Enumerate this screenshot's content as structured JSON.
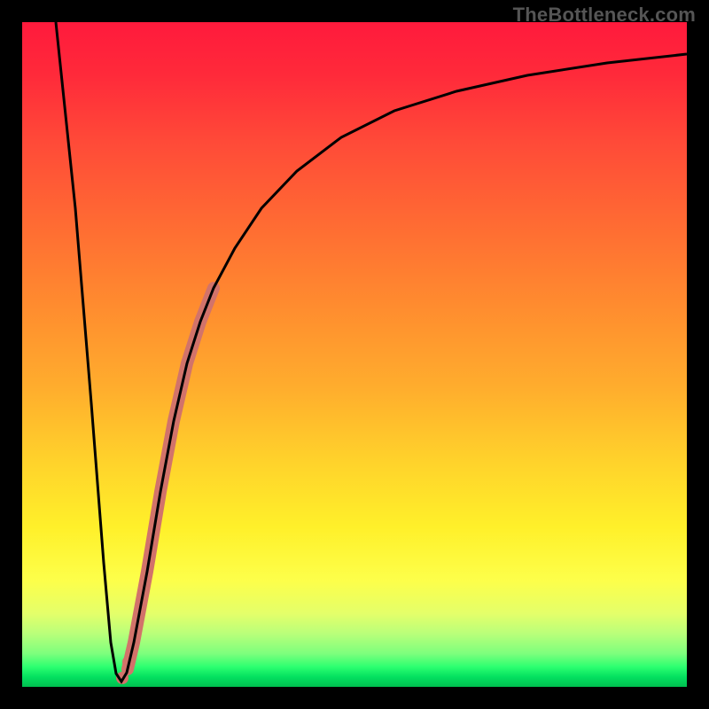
{
  "watermark": {
    "text": "TheBottleneck.com"
  },
  "colors": {
    "curve": "#000000",
    "highlight": "#d2736a",
    "gradient_top": "#ff1a3c",
    "gradient_mid": "#ffd22b",
    "gradient_bottom": "#00c050"
  },
  "chart_data": {
    "type": "line",
    "title": "",
    "xlabel": "",
    "ylabel": "",
    "xlim": [
      0,
      100
    ],
    "ylim": [
      0,
      100
    ],
    "note": "Axis values are relative percentages inferred from unlabeled plot; y read as distance from bottom (0) to top (100).",
    "series": [
      {
        "name": "bottleneck-curve",
        "x": [
          5,
          8,
          10,
          12,
          13,
          14,
          15,
          16,
          18,
          20,
          22,
          24,
          26,
          28,
          30,
          34,
          38,
          44,
          52,
          62,
          74,
          88,
          100
        ],
        "y": [
          100,
          60,
          30,
          10,
          3,
          1,
          2,
          5,
          15,
          28,
          40,
          50,
          56,
          62,
          67,
          74,
          79,
          84,
          88,
          91,
          93,
          94.5,
          95.5
        ]
      }
    ],
    "highlight_segment": {
      "description": "Thick salmon overlay on the rising limb near the trough",
      "x": [
        15.5,
        16.5,
        18,
        20,
        22,
        24,
        26,
        28
      ],
      "y": [
        3,
        6,
        15,
        28,
        40,
        50,
        56,
        62
      ]
    },
    "highlight_dots": {
      "x": [
        15.0,
        15.8
      ],
      "y": [
        1.5,
        4
      ]
    }
  }
}
